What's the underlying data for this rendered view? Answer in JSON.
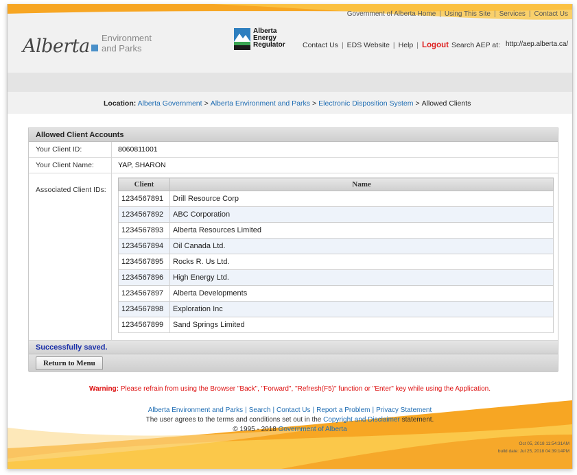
{
  "header": {
    "gov_links": [
      "Government of Alberta Home",
      "Using This Site",
      "Services",
      "Contact Us"
    ],
    "logo_alberta": "Alberta",
    "logo_env_line1": "Environment",
    "logo_env_line2": "and Parks",
    "aer_line1": "Alberta",
    "aer_line2": "Energy",
    "aer_line3": "Regulator",
    "util_links": {
      "contact": "Contact Us",
      "eds": "EDS Website",
      "help": "Help",
      "logout": "Logout",
      "search_label": "Search AEP at:"
    },
    "search_value": "http://aep.alberta.ca/"
  },
  "breadcrumb": {
    "label": "Location:",
    "items": [
      "Alberta Government",
      "Alberta Environment and Parks",
      "Electronic Disposition System",
      "Allowed Clients"
    ]
  },
  "panel": {
    "title": "Allowed Client Accounts",
    "client_id_label": "Your Client ID:",
    "client_id_value": "8060811001",
    "client_name_label": "Your Client Name:",
    "client_name_value": "YAP, SHARON",
    "associated_label": "Associated Client IDs:",
    "table": {
      "headers": [
        "Client",
        "Name"
      ],
      "rows": [
        {
          "id": "1234567891",
          "name": "Drill Resource Corp"
        },
        {
          "id": "1234567892",
          "name": "ABC Corporation"
        },
        {
          "id": "1234567893",
          "name": "Alberta Resources Limited"
        },
        {
          "id": "1234567894",
          "name": "Oil Canada Ltd."
        },
        {
          "id": "1234567895",
          "name": "Rocks R. Us Ltd."
        },
        {
          "id": "1234567896",
          "name": "High Energy Ltd."
        },
        {
          "id": "1234567897",
          "name": "Alberta Developments"
        },
        {
          "id": "1234567898",
          "name": "Exploration Inc"
        },
        {
          "id": "1234567899",
          "name": "Sand Springs Limited"
        }
      ]
    },
    "status": "Successfully saved.",
    "return_button": "Return to Menu"
  },
  "warning": {
    "label": "Warning:",
    "text": "Please refrain from using the Browser \"Back\", \"Forward\", \"Refresh(F5)\" function or \"Enter\" key while using the Application."
  },
  "footer": {
    "links": [
      "Alberta Environment and Parks",
      "Search",
      "Contact Us",
      "Report a Problem",
      "Privacy Statement"
    ],
    "terms_pre": "The user agrees to the terms and conditions set out in the",
    "terms_link": "Copyright and Disclaimer",
    "terms_post": "statement.",
    "copyright_pre": "© 1995 - 2018",
    "copyright_link": "Government of Alberta",
    "timestamp": "Oct 05, 2018 11:54:31AM",
    "build_date": "build date: Jul 25, 2018 04:39:14PM"
  },
  "colors": {
    "accent_orange": "#f7a623",
    "link_blue": "#1f6db3",
    "logout_red": "#dd2222",
    "status_blue": "#1a2fa8"
  }
}
